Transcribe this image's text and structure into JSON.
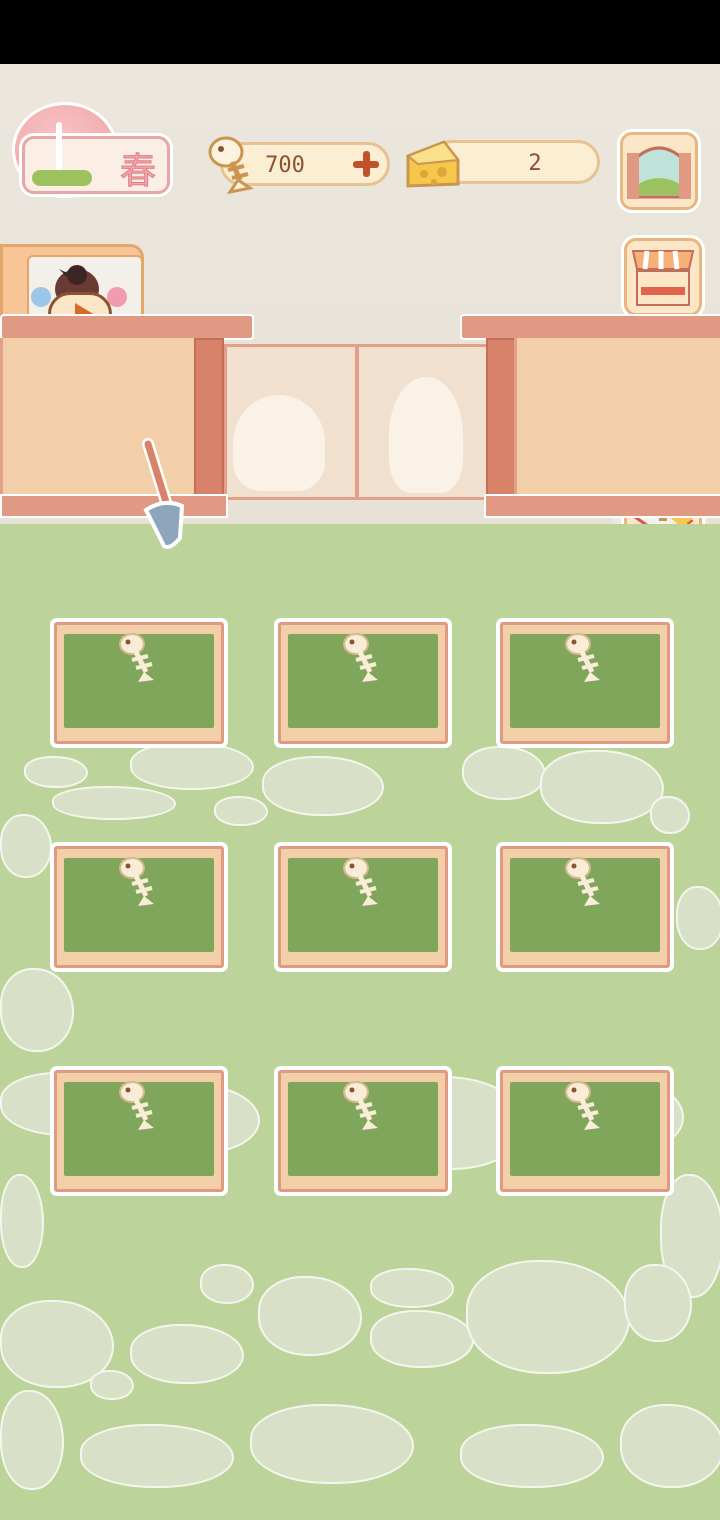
{
  "status_bar": {},
  "header": {
    "season_char": "春",
    "fish_count": "700",
    "cheese_count": "2"
  },
  "icons": {
    "season": "cherry-tree-icon",
    "fish_currency": "fish-bone-icon",
    "cheese_currency": "cheese-icon",
    "add": "plus-icon",
    "window": "window-icon",
    "shop": "shop-stall-icon",
    "basket": "basket-icon",
    "trophy": "trophy-icon",
    "collapse": "minus-icon",
    "video": "play-icon",
    "shovel": "shovel-icon",
    "plot_seed": "fish-bone-icon"
  },
  "colors": {
    "accent": "#c0522a",
    "lawn": "#bcd49a",
    "plot_soil": "#7fa65b",
    "fence": "#e09a83"
  },
  "garden": {
    "rows": 3,
    "columns": 3,
    "plots": [
      {
        "state": "empty"
      },
      {
        "state": "empty"
      },
      {
        "state": "empty"
      },
      {
        "state": "empty"
      },
      {
        "state": "empty"
      },
      {
        "state": "empty"
      },
      {
        "state": "empty"
      },
      {
        "state": "empty"
      },
      {
        "state": "empty"
      }
    ]
  }
}
